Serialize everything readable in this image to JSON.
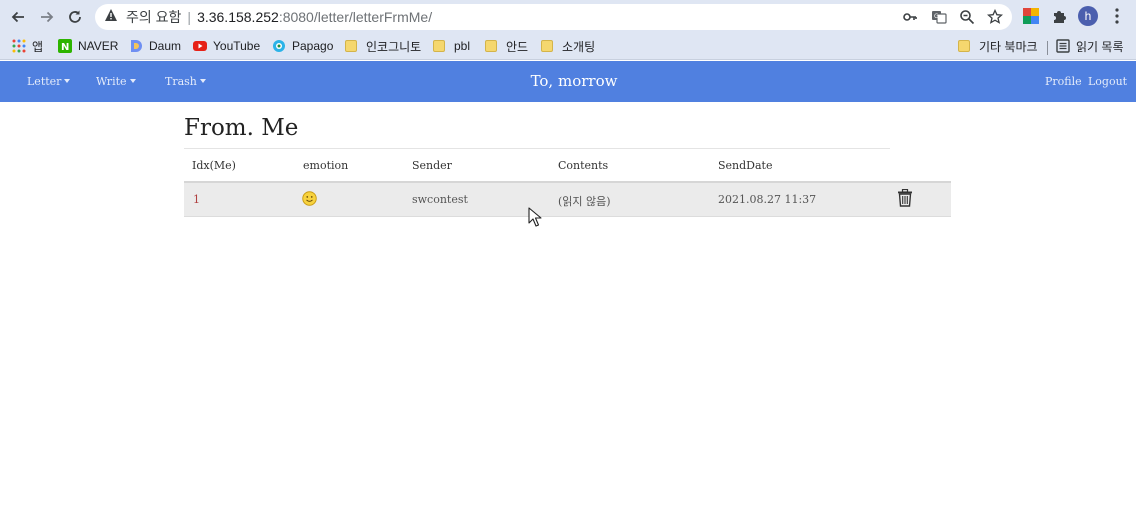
{
  "browser": {
    "url_warning": "주의 요함",
    "url_host": "3.36.158.252",
    "url_path": ":8080/letter/letterFrmMe/",
    "avatar_letter": "h",
    "bookmarks": {
      "apps": "앱",
      "naver": "NAVER",
      "daum": "Daum",
      "youtube": "YouTube",
      "papago": "Papago",
      "folder1": "인코그니토",
      "folder2": "pbl",
      "folder3": "안드",
      "folder4": "소개팅",
      "other": "기타 북마크",
      "reading_list": "읽기 목록"
    }
  },
  "navbar": {
    "brand": "To, morrow",
    "menu_letter": "Letter",
    "menu_write": "Write",
    "menu_trash": "Trash",
    "profile": "Profile",
    "logout": "Logout",
    "color": "#5080e0"
  },
  "page": {
    "title": "From. Me"
  },
  "table": {
    "headers": {
      "idx": "Idx(Me)",
      "emotion": "emotion",
      "sender": "Sender",
      "contents": "Contents",
      "send_date": "SendDate"
    },
    "rows": [
      {
        "idx": "1",
        "emotion_icon": "smiley-face-icon",
        "sender": "swcontest",
        "contents": "(읽지 않음)",
        "send_date": "2021.08.27 11:37",
        "action_icon": "trash-icon"
      }
    ]
  }
}
